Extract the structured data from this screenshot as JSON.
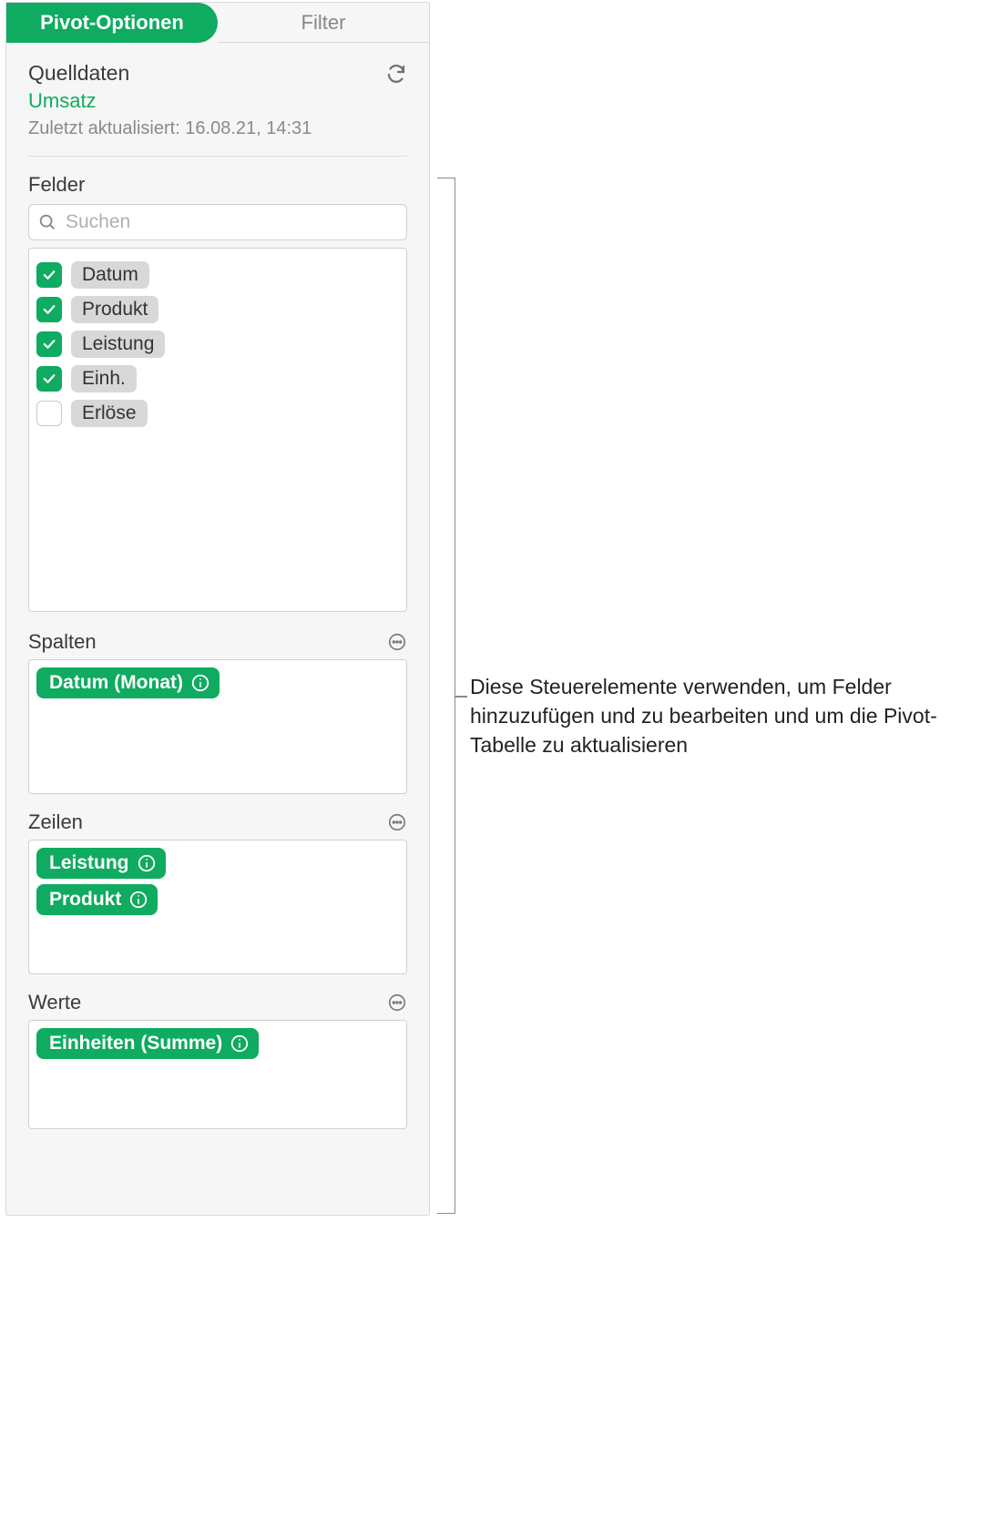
{
  "tabs": {
    "pivot": "Pivot-Optionen",
    "filter": "Filter"
  },
  "source": {
    "heading": "Quelldaten",
    "name": "Umsatz",
    "lastUpdated": "Zuletzt aktualisiert: 16.08.21, 14:31"
  },
  "fields": {
    "label": "Felder",
    "searchPlaceholder": "Suchen",
    "items": [
      {
        "label": "Datum",
        "checked": true
      },
      {
        "label": "Produkt",
        "checked": true
      },
      {
        "label": "Leistung",
        "checked": true
      },
      {
        "label": "Einh.",
        "checked": true
      },
      {
        "label": "Erlöse",
        "checked": false
      }
    ]
  },
  "zones": {
    "columns": {
      "label": "Spalten",
      "chips": [
        "Datum (Monat)"
      ]
    },
    "rows": {
      "label": "Zeilen",
      "chips": [
        "Leistung",
        "Produkt"
      ]
    },
    "values": {
      "label": "Werte",
      "chips": [
        "Einheiten (Summe)"
      ]
    }
  },
  "callout": "Diese Steuerelemente verwenden, um Felder hinzuzufügen und zu bearbeiten und um die Pivot-Tabelle zu aktualisieren"
}
